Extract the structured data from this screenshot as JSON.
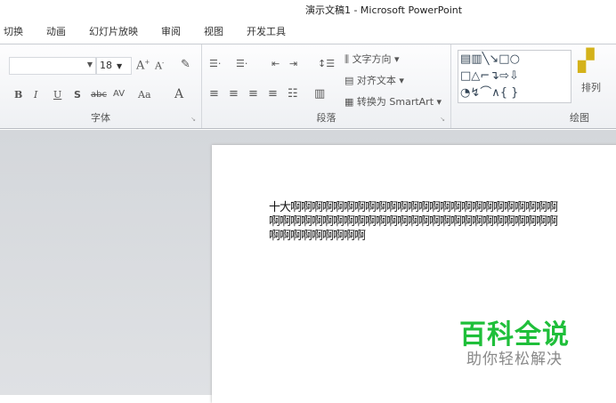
{
  "window": {
    "title": "演示文稿1 - Microsoft PowerPoint"
  },
  "tabs": [
    "切换",
    "动画",
    "幻灯片放映",
    "审阅",
    "视图",
    "开发工具"
  ],
  "ribbon": {
    "font_group": {
      "label": "字体",
      "font_size": "18",
      "bold": "B",
      "italic": "I",
      "underline": "U",
      "shadow": "S",
      "strike": "abc",
      "spacing": "AV",
      "case": "Aa",
      "color": "A"
    },
    "paragraph_group": {
      "label": "段落",
      "text_direction": "文字方向",
      "align_text": "对齐文本",
      "smartart": "转换为 SmartArt"
    },
    "drawing_group": {
      "label": "绘图",
      "arrange": "排列"
    }
  },
  "slide": {
    "text": "十大啊啊啊啊啊啊啊啊啊啊啊啊啊啊啊啊啊啊啊啊啊啊啊啊啊啊啊啊啊啊啊啊啊啊啊啊啊啊啊啊啊啊啊啊啊啊啊啊啊啊啊啊啊啊啊啊啊啊啊啊啊"
  },
  "watermark": {
    "title": "百科全说",
    "subtitle": "助你轻松解决"
  }
}
